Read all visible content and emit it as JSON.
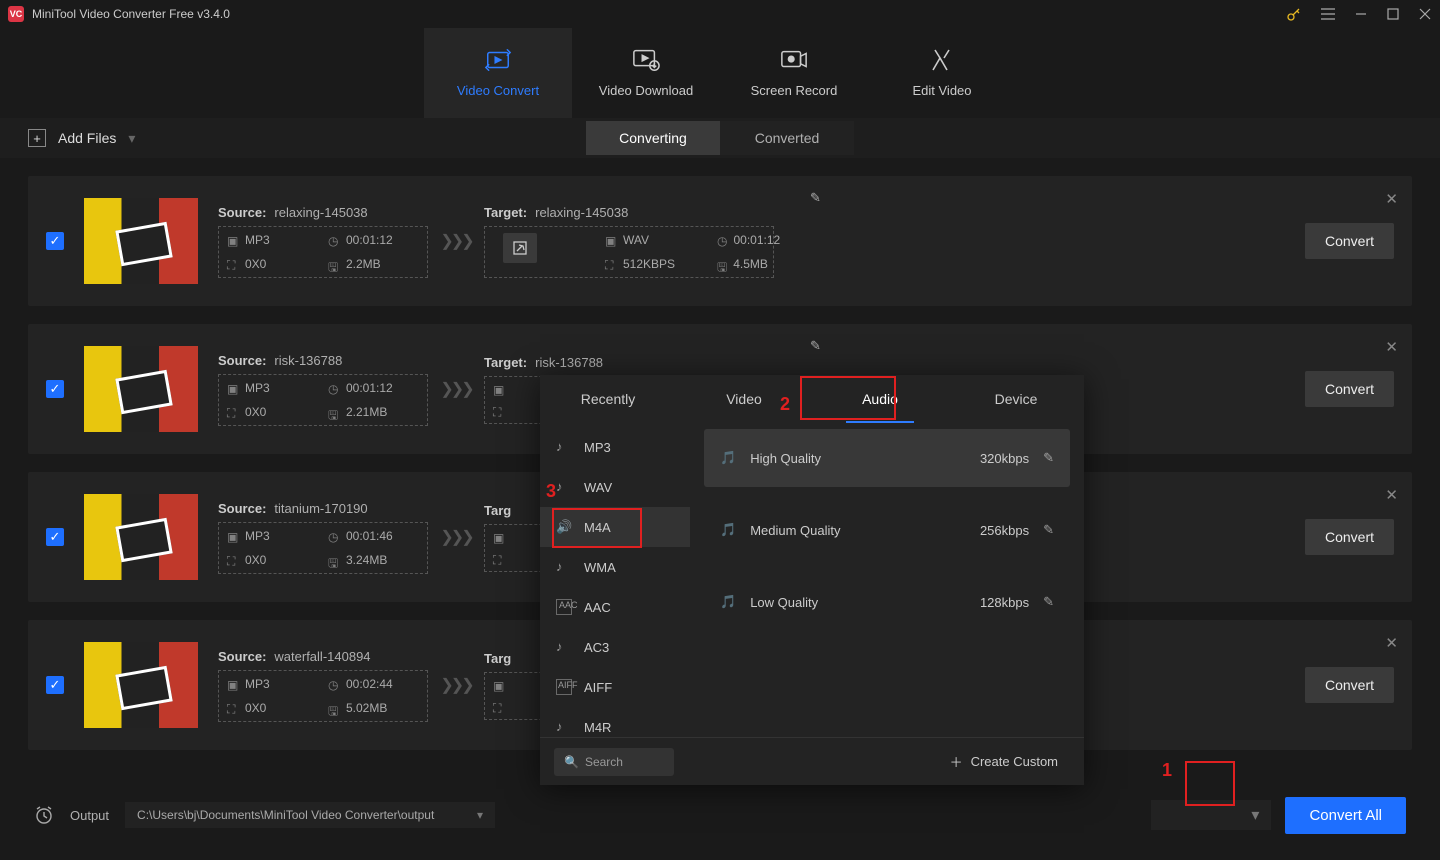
{
  "app": {
    "title": "MiniTool Video Converter Free v3.4.0",
    "icon_text": "VC"
  },
  "nav": {
    "video_convert": "Video Convert",
    "video_download": "Video Download",
    "screen_record": "Screen Record",
    "edit_video": "Edit Video"
  },
  "toolbar": {
    "add_files": "Add Files",
    "converting": "Converting",
    "converted": "Converted"
  },
  "labels": {
    "source": "Source:",
    "target": "Target:",
    "convert": "Convert"
  },
  "files": [
    {
      "name": "relaxing-145038",
      "src": {
        "fmt": "MP3",
        "dur": "00:01:12",
        "res": "0X0",
        "size": "2.2MB"
      },
      "tgt": {
        "name": "relaxing-145038",
        "fmt": "WAV",
        "dur": "00:01:12",
        "bitrate": "512KBPS",
        "size": "4.5MB"
      }
    },
    {
      "name": "risk-136788",
      "src": {
        "fmt": "MP3",
        "dur": "00:01:12",
        "res": "0X0",
        "size": "2.21MB"
      },
      "tgt": {
        "name": "risk-136788"
      }
    },
    {
      "name": "titanium-170190",
      "src": {
        "fmt": "MP3",
        "dur": "00:01:46",
        "res": "0X0",
        "size": "3.24MB"
      },
      "tgt": {
        "name": ""
      }
    },
    {
      "name": "waterfall-140894",
      "src": {
        "fmt": "MP3",
        "dur": "00:02:44",
        "res": "0X0",
        "size": "5.02MB"
      },
      "tgt": {
        "name": ""
      }
    }
  ],
  "popup": {
    "tabs": {
      "recently": "Recently",
      "video": "Video",
      "audio": "Audio",
      "device": "Device"
    },
    "formats": [
      "MP3",
      "WAV",
      "M4A",
      "WMA",
      "AAC",
      "AC3",
      "AIFF",
      "M4R"
    ],
    "selected_format_index": 2,
    "qualities": [
      {
        "name": "High Quality",
        "bitrate": "320kbps"
      },
      {
        "name": "Medium Quality",
        "bitrate": "256kbps"
      },
      {
        "name": "Low Quality",
        "bitrate": "128kbps"
      }
    ],
    "search_placeholder": "Search",
    "create_custom": "Create Custom"
  },
  "bottom": {
    "output_label": "Output",
    "output_path": "C:\\Users\\bj\\Documents\\MiniTool Video Converter\\output",
    "convert_all": "Convert All"
  },
  "annotations": {
    "n1": "1",
    "n2": "2",
    "n3": "3"
  },
  "targ_short": "Targ"
}
